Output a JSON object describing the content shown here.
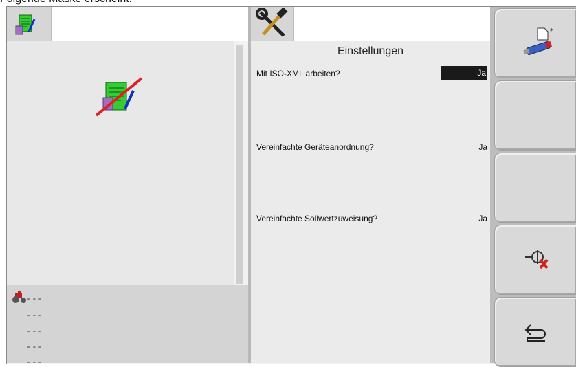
{
  "caption": "Folgende Maske erscheint:",
  "left_panel": {
    "tab_icon": "task-data-icon",
    "main_icon": "task-data-disabled-icon",
    "tractor_icon": "tractor-icon",
    "info_lines": [
      "---",
      "---",
      "---",
      "---",
      "---"
    ]
  },
  "settings": {
    "tab_icon": "tools-icon",
    "title": "Einstellungen",
    "items": [
      {
        "label": "Mit ISO-XML arbeiten?",
        "value": "Ja",
        "selected": true
      },
      {
        "label": "Vereinfachte Geräteanordnung?",
        "value": "Ja",
        "selected": false
      },
      {
        "label": "Vereinfachte Sollwertzuweisung?",
        "value": "Ja",
        "selected": false
      }
    ]
  },
  "softkeys": [
    {
      "icon": "usb-new-file-icon"
    },
    {
      "icon": ""
    },
    {
      "icon": ""
    },
    {
      "icon": "disconnect-icon"
    },
    {
      "icon": "back-icon"
    }
  ]
}
